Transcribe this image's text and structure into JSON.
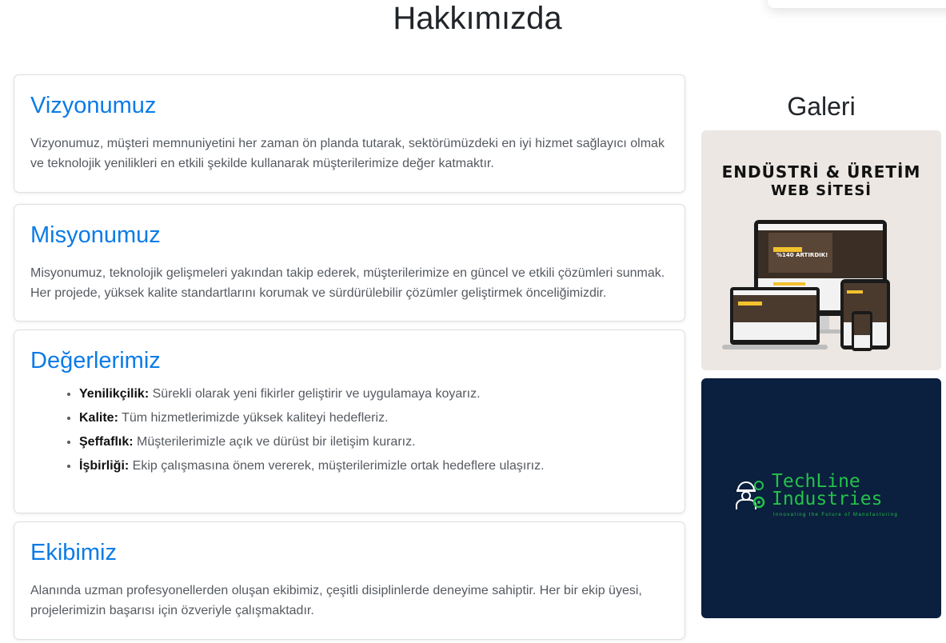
{
  "page": {
    "title": "Hakkımızda"
  },
  "cards": {
    "vision": {
      "heading": "Vizyonumuz",
      "text": "Vizyonumuz, müşteri memnuniyetini her zaman ön planda tutarak, sektörümüzdeki en iyi hizmet sağlayıcı olmak ve teknolojik yenilikleri en etkili şekilde kullanarak müşterilerimize değer katmaktır."
    },
    "mission": {
      "heading": "Misyonumuz",
      "text": "Misyonumuz, teknolojik gelişmeleri yakından takip ederek, müşterilerimize en güncel ve etkili çözümleri sunmak. Her projede, yüksek kalite standartlarını korumak ve sürdürülebilir çözümler geliştirmek önceliğimizdir."
    },
    "values": {
      "heading": "Değerlerimiz",
      "items": [
        {
          "term": "Yenilikçilik:",
          "desc": " Sürekli olarak yeni fikirler geliştirir ve uygulamaya koyarız."
        },
        {
          "term": "Kalite:",
          "desc": " Tüm hizmetlerimizde yüksek kaliteyi hedefleriz."
        },
        {
          "term": "Şeffaflık:",
          "desc": " Müşterilerimizle açık ve dürüst bir iletişim kurarız."
        },
        {
          "term": "İşbirliği:",
          "desc": " Ekip çalışmasına önem vererek, müşterilerimizle ortak hedeflere ulaşırız."
        }
      ]
    },
    "team": {
      "heading": "Ekibimiz",
      "text": "Alanında uzman profesyonellerden oluşan ekibimiz, çeşitli disiplinlerde deneyime sahiptir. Her bir ekip üyesi, projelerimizin başarısı için özveriyle çalışmaktadır."
    }
  },
  "gallery": {
    "title": "Galeri",
    "image1": {
      "title_line1": "ENDÜSTRİ & ÜRETİM",
      "title_line2": "WEB SİTESİ",
      "screen_headline": "%140 ARTIRDIK!"
    },
    "image2": {
      "brand_line1": "TechLine",
      "brand_line2": "Industries",
      "tagline": "Innovating the Future of Manufacturing"
    }
  },
  "colors": {
    "heading_blue": "#0b7be6",
    "brand_green": "#23c24a",
    "navy": "#0b1f3e"
  }
}
